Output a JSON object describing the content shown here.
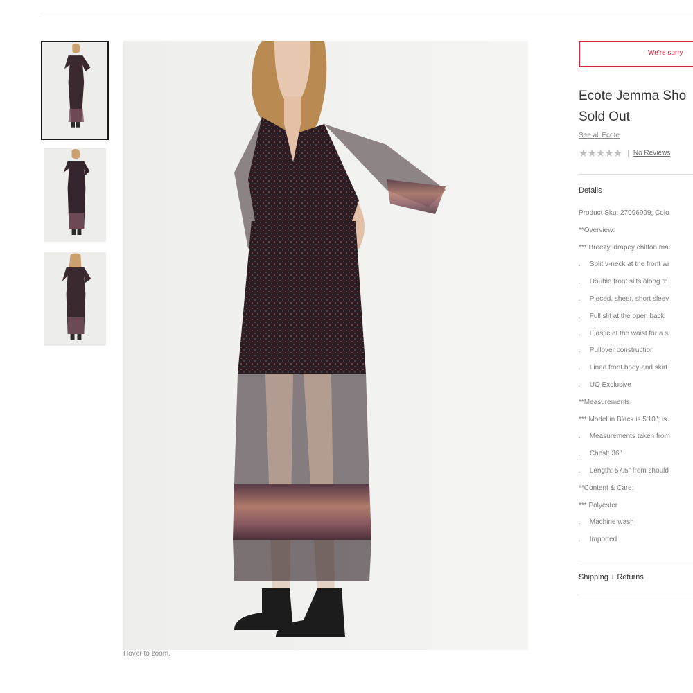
{
  "gallery": {
    "hover_hint": "Hover to zoom.",
    "thumbnails": [
      "front view",
      "side view",
      "back view"
    ],
    "selected_index": 0
  },
  "product": {
    "alert": "We're sorry",
    "title_line1": "Ecote Jemma Sho",
    "title_line2": "Sold Out",
    "brand_link": "See all Ecote",
    "rating_stars": "★★★★★",
    "rating_separator": "|",
    "reviews_link": "No Reviews"
  },
  "details": {
    "heading": "Details",
    "lines": [
      {
        "text": "Product Sku: 27096999; Colo",
        "bullet": false
      },
      {
        "text": "**Overview:",
        "bullet": false
      },
      {
        "text": "*** Breezy, drapey chiffon ma",
        "bullet": false
      },
      {
        "text": "Split v-neck at the front wi",
        "bullet": true
      },
      {
        "text": "Double front slits along th",
        "bullet": true
      },
      {
        "text": "Pieced, sheer, short sleev",
        "bullet": true
      },
      {
        "text": "Full slit at the open back",
        "bullet": true
      },
      {
        "text": "Elastic at the waist for a s",
        "bullet": true
      },
      {
        "text": "Pullover construction",
        "bullet": true
      },
      {
        "text": "Lined front body and skirt",
        "bullet": true
      },
      {
        "text": "UO Exclusive",
        "bullet": true
      },
      {
        "text": "**Measurements:",
        "bullet": false
      },
      {
        "text": "*** Model in Black is 5'10\"; is",
        "bullet": false
      },
      {
        "text": "Measurements taken from",
        "bullet": true
      },
      {
        "text": "Chest: 36\"",
        "bullet": true
      },
      {
        "text": "Length: 57.5\" from should",
        "bullet": true
      },
      {
        "text": "**Content & Care:",
        "bullet": false
      },
      {
        "text": "*** Polyester",
        "bullet": false
      },
      {
        "text": "Machine wash",
        "bullet": true
      },
      {
        "text": "Imported",
        "bullet": true
      }
    ]
  },
  "shipping": {
    "heading": "Shipping + Returns"
  },
  "colors": {
    "alert_red": "#d4233b",
    "dress_dark": "#2b1c22",
    "border_print": "#8a5a63"
  }
}
